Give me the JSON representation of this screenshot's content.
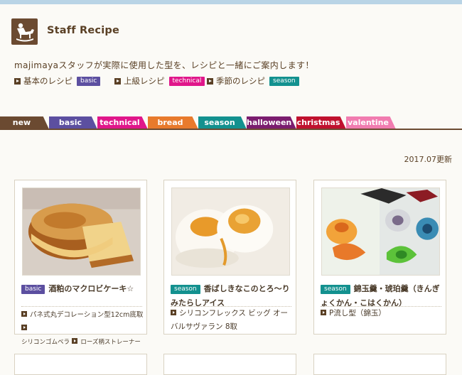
{
  "header": {
    "site_title": "Staff Recipe",
    "intro": "majimayaスタッフが実際に使用した型を、レシピと一緒にご案内します！",
    "updated": "2017.07更新"
  },
  "quick_links": [
    {
      "label": "基本のレシピ",
      "badge": "basic",
      "color": "#5c4fa0"
    },
    {
      "label": "上級レシピ",
      "badge": "technical",
      "color": "#e0168a"
    },
    {
      "label": "季節のレシピ",
      "badge": "season",
      "color": "#13918f"
    }
  ],
  "tabs": [
    {
      "label": "new",
      "color": "#6b4a31"
    },
    {
      "label": "basic",
      "color": "#5c4fa0"
    },
    {
      "label": "technical",
      "color": "#e0168a"
    },
    {
      "label": "bread",
      "color": "#e87a2c"
    },
    {
      "label": "season",
      "color": "#13918f"
    },
    {
      "label": "halloween",
      "color": "#7b1d6f"
    },
    {
      "label": "christmas",
      "color": "#c0112e"
    },
    {
      "label": "valentine",
      "color": "#f17cb0"
    }
  ],
  "cards": [
    {
      "badge": "basic",
      "badge_color": "#5c4fa0",
      "title": "酒粕のマクロビケーキ☆",
      "tools": [
        "パネ式丸デコレーション型12cm底取",
        "シリコンゴムベラ",
        "ローズ柄ストレーナー"
      ]
    },
    {
      "badge": "season",
      "badge_color": "#13918f",
      "title": "香ばしきなこのとろ〜りみたらしアイス",
      "tools": [
        "シリコンフレックス ビッグ オーバルサヴァラン 8取"
      ]
    },
    {
      "badge": "season",
      "badge_color": "#13918f",
      "title": "錦玉羹・琥珀羹（きんぎょくかん・こはくかん）",
      "tools": [
        "P流し型（錦玉）"
      ]
    }
  ]
}
